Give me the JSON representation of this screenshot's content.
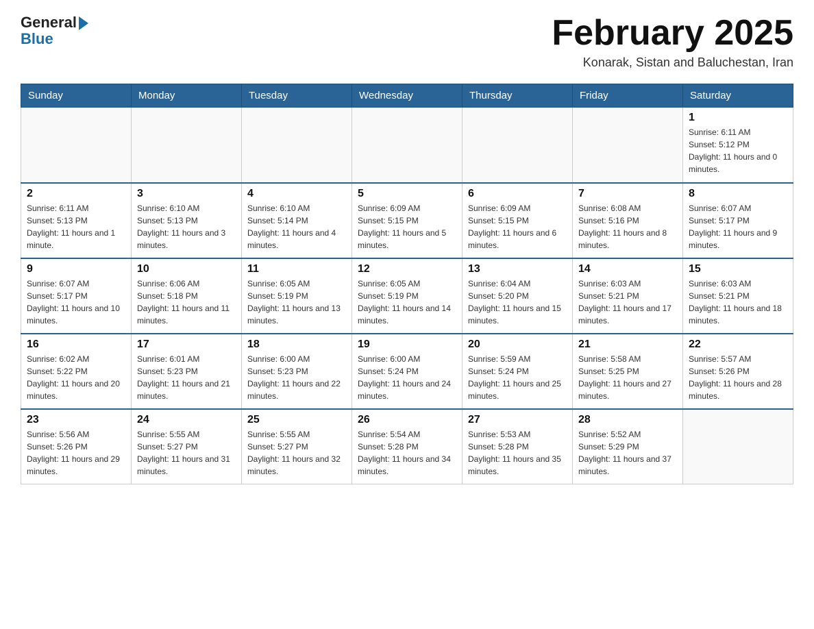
{
  "header": {
    "logo_general": "General",
    "logo_blue": "Blue",
    "month_title": "February 2025",
    "location": "Konarak, Sistan and Baluchestan, Iran"
  },
  "days_of_week": [
    "Sunday",
    "Monday",
    "Tuesday",
    "Wednesday",
    "Thursday",
    "Friday",
    "Saturday"
  ],
  "weeks": [
    [
      {
        "day": "",
        "info": ""
      },
      {
        "day": "",
        "info": ""
      },
      {
        "day": "",
        "info": ""
      },
      {
        "day": "",
        "info": ""
      },
      {
        "day": "",
        "info": ""
      },
      {
        "day": "",
        "info": ""
      },
      {
        "day": "1",
        "info": "Sunrise: 6:11 AM\nSunset: 5:12 PM\nDaylight: 11 hours and 0 minutes."
      }
    ],
    [
      {
        "day": "2",
        "info": "Sunrise: 6:11 AM\nSunset: 5:13 PM\nDaylight: 11 hours and 1 minute."
      },
      {
        "day": "3",
        "info": "Sunrise: 6:10 AM\nSunset: 5:13 PM\nDaylight: 11 hours and 3 minutes."
      },
      {
        "day": "4",
        "info": "Sunrise: 6:10 AM\nSunset: 5:14 PM\nDaylight: 11 hours and 4 minutes."
      },
      {
        "day": "5",
        "info": "Sunrise: 6:09 AM\nSunset: 5:15 PM\nDaylight: 11 hours and 5 minutes."
      },
      {
        "day": "6",
        "info": "Sunrise: 6:09 AM\nSunset: 5:15 PM\nDaylight: 11 hours and 6 minutes."
      },
      {
        "day": "7",
        "info": "Sunrise: 6:08 AM\nSunset: 5:16 PM\nDaylight: 11 hours and 8 minutes."
      },
      {
        "day": "8",
        "info": "Sunrise: 6:07 AM\nSunset: 5:17 PM\nDaylight: 11 hours and 9 minutes."
      }
    ],
    [
      {
        "day": "9",
        "info": "Sunrise: 6:07 AM\nSunset: 5:17 PM\nDaylight: 11 hours and 10 minutes."
      },
      {
        "day": "10",
        "info": "Sunrise: 6:06 AM\nSunset: 5:18 PM\nDaylight: 11 hours and 11 minutes."
      },
      {
        "day": "11",
        "info": "Sunrise: 6:05 AM\nSunset: 5:19 PM\nDaylight: 11 hours and 13 minutes."
      },
      {
        "day": "12",
        "info": "Sunrise: 6:05 AM\nSunset: 5:19 PM\nDaylight: 11 hours and 14 minutes."
      },
      {
        "day": "13",
        "info": "Sunrise: 6:04 AM\nSunset: 5:20 PM\nDaylight: 11 hours and 15 minutes."
      },
      {
        "day": "14",
        "info": "Sunrise: 6:03 AM\nSunset: 5:21 PM\nDaylight: 11 hours and 17 minutes."
      },
      {
        "day": "15",
        "info": "Sunrise: 6:03 AM\nSunset: 5:21 PM\nDaylight: 11 hours and 18 minutes."
      }
    ],
    [
      {
        "day": "16",
        "info": "Sunrise: 6:02 AM\nSunset: 5:22 PM\nDaylight: 11 hours and 20 minutes."
      },
      {
        "day": "17",
        "info": "Sunrise: 6:01 AM\nSunset: 5:23 PM\nDaylight: 11 hours and 21 minutes."
      },
      {
        "day": "18",
        "info": "Sunrise: 6:00 AM\nSunset: 5:23 PM\nDaylight: 11 hours and 22 minutes."
      },
      {
        "day": "19",
        "info": "Sunrise: 6:00 AM\nSunset: 5:24 PM\nDaylight: 11 hours and 24 minutes."
      },
      {
        "day": "20",
        "info": "Sunrise: 5:59 AM\nSunset: 5:24 PM\nDaylight: 11 hours and 25 minutes."
      },
      {
        "day": "21",
        "info": "Sunrise: 5:58 AM\nSunset: 5:25 PM\nDaylight: 11 hours and 27 minutes."
      },
      {
        "day": "22",
        "info": "Sunrise: 5:57 AM\nSunset: 5:26 PM\nDaylight: 11 hours and 28 minutes."
      }
    ],
    [
      {
        "day": "23",
        "info": "Sunrise: 5:56 AM\nSunset: 5:26 PM\nDaylight: 11 hours and 29 minutes."
      },
      {
        "day": "24",
        "info": "Sunrise: 5:55 AM\nSunset: 5:27 PM\nDaylight: 11 hours and 31 minutes."
      },
      {
        "day": "25",
        "info": "Sunrise: 5:55 AM\nSunset: 5:27 PM\nDaylight: 11 hours and 32 minutes."
      },
      {
        "day": "26",
        "info": "Sunrise: 5:54 AM\nSunset: 5:28 PM\nDaylight: 11 hours and 34 minutes."
      },
      {
        "day": "27",
        "info": "Sunrise: 5:53 AM\nSunset: 5:28 PM\nDaylight: 11 hours and 35 minutes."
      },
      {
        "day": "28",
        "info": "Sunrise: 5:52 AM\nSunset: 5:29 PM\nDaylight: 11 hours and 37 minutes."
      },
      {
        "day": "",
        "info": ""
      }
    ]
  ]
}
